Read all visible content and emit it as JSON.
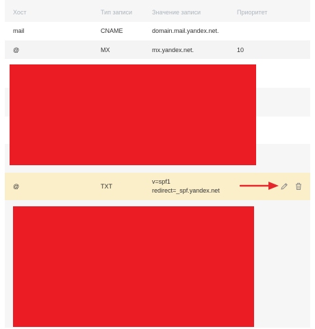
{
  "table": {
    "headers": {
      "host": "Хост",
      "type": "Тип записи",
      "value": "Значение записи",
      "priority": "Приоритет"
    },
    "rows": [
      {
        "host": "mail",
        "type": "CNAME",
        "value": "domain.mail.yandex.net.",
        "priority": ""
      },
      {
        "host": "@",
        "type": "MX",
        "value": "mx.yandex.net.",
        "priority": "10"
      }
    ],
    "highlighted_row": {
      "host": "@",
      "type": "TXT",
      "value_line1": "v=spf1",
      "value_line2": "redirect=_spf.yandex.net"
    }
  },
  "icons": {
    "edit": "pencil-icon",
    "delete": "trash-icon",
    "annotation": "arrow-right-icon"
  },
  "colors": {
    "highlight_row": "#fbefc9",
    "header_text": "#aeb6be",
    "redaction": "#ec1c24",
    "arrow": "#e3272d",
    "icon": "#8a8a8a"
  }
}
